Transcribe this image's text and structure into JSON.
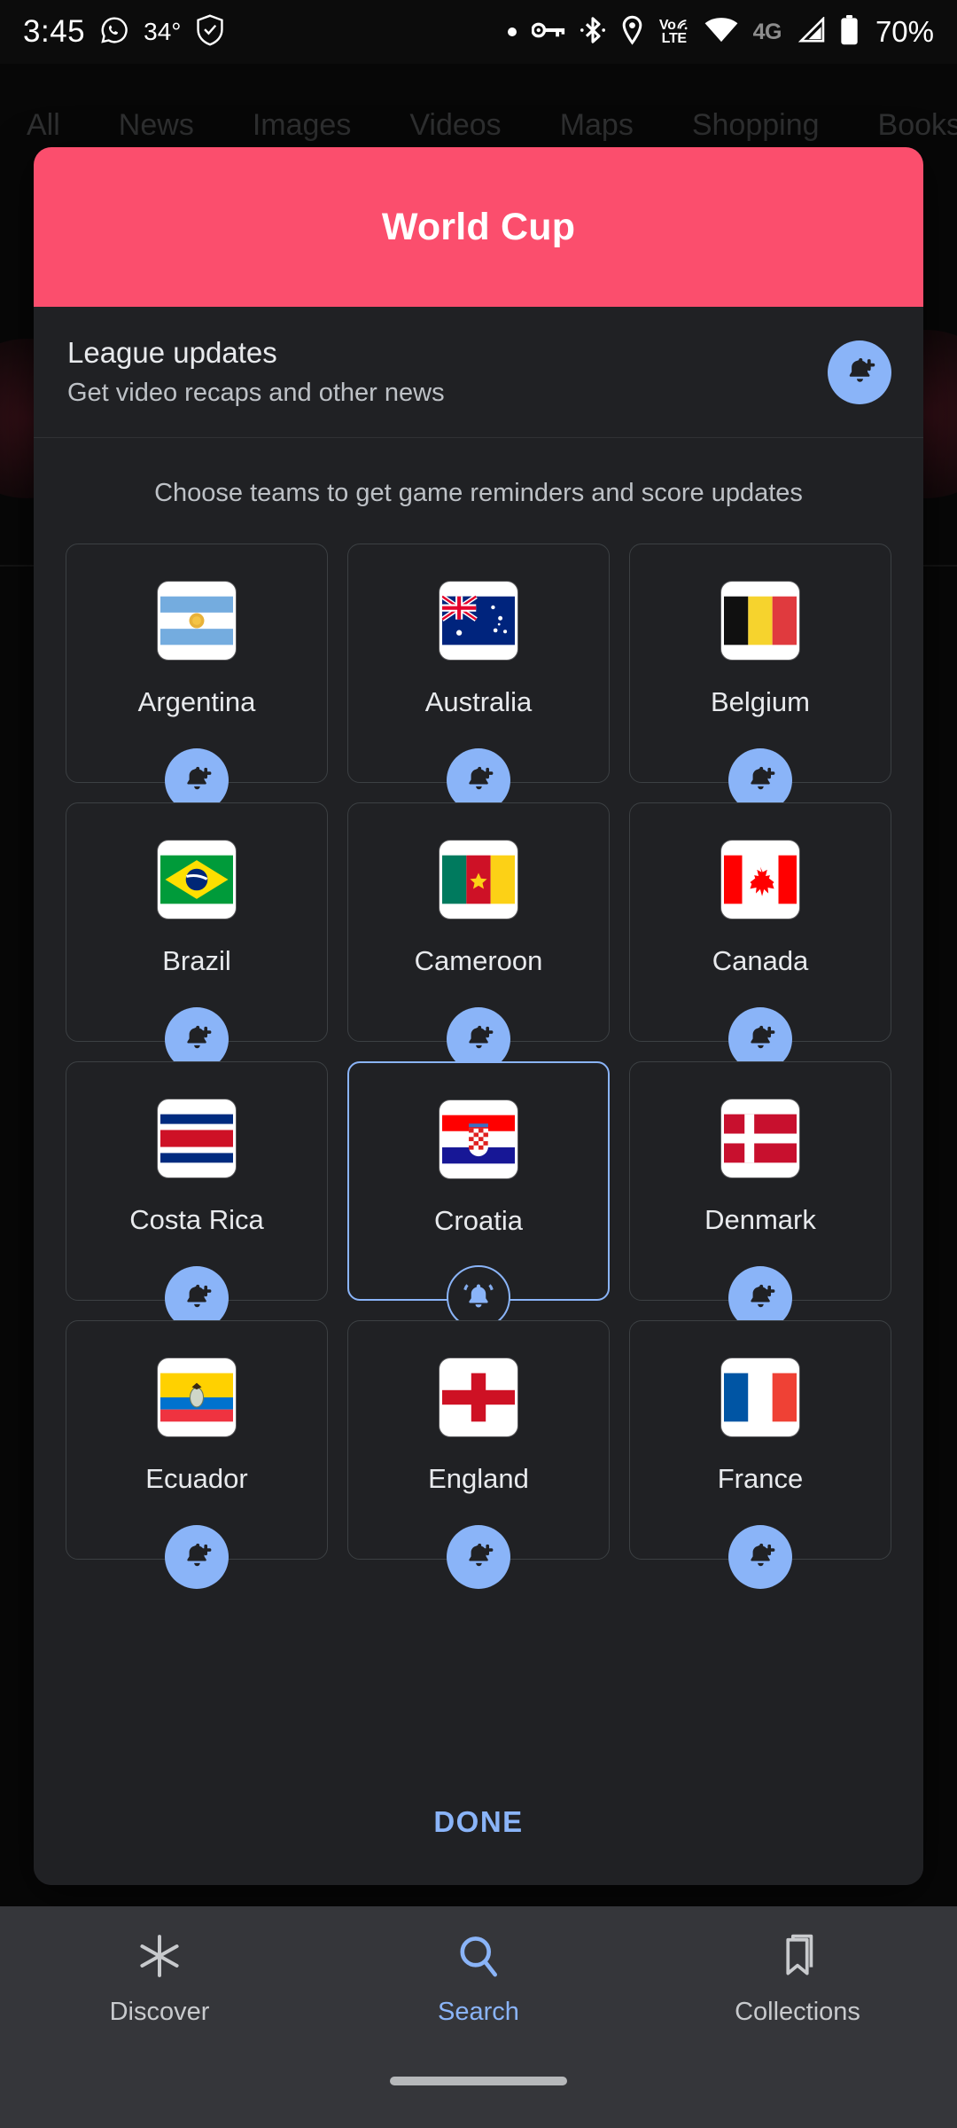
{
  "status_bar": {
    "time": "3:45",
    "temperature": "34°",
    "battery_percent": "70%",
    "network_type": "4G",
    "volte_top": "Vo",
    "volte_bottom": "LTE",
    "icons": [
      "whatsapp-icon",
      "shield-icon",
      "dot-icon",
      "key-icon",
      "bluetooth-icon",
      "location-icon",
      "volte-icon",
      "wifi-icon",
      "signal-icon",
      "battery-icon"
    ]
  },
  "background_page": {
    "tabs": [
      "All",
      "News",
      "Images",
      "Videos",
      "Maps",
      "Shopping",
      "Books"
    ]
  },
  "dialog": {
    "title": "World Cup",
    "header_color": "#fb4e6d",
    "league_updates": {
      "title": "League updates",
      "subtitle": "Get video recaps and other news",
      "bell_state": "add"
    },
    "choose_prompt": "Choose teams to get game reminders and score updates",
    "accent_color": "#8ab4f8",
    "teams": [
      {
        "name": "Argentina",
        "selected": false,
        "bell_state": "add"
      },
      {
        "name": "Australia",
        "selected": false,
        "bell_state": "add"
      },
      {
        "name": "Belgium",
        "selected": false,
        "bell_state": "add"
      },
      {
        "name": "Brazil",
        "selected": false,
        "bell_state": "add"
      },
      {
        "name": "Cameroon",
        "selected": false,
        "bell_state": "add"
      },
      {
        "name": "Canada",
        "selected": false,
        "bell_state": "add"
      },
      {
        "name": "Costa Rica",
        "selected": false,
        "bell_state": "add"
      },
      {
        "name": "Croatia",
        "selected": true,
        "bell_state": "on"
      },
      {
        "name": "Denmark",
        "selected": false,
        "bell_state": "add"
      },
      {
        "name": "Ecuador",
        "selected": false,
        "bell_state": "add"
      },
      {
        "name": "England",
        "selected": false,
        "bell_state": "add"
      },
      {
        "name": "France",
        "selected": false,
        "bell_state": "add"
      }
    ],
    "done_label": "DONE"
  },
  "bottom_nav": {
    "items": [
      {
        "label": "Discover",
        "icon": "asterisk-icon",
        "active": false
      },
      {
        "label": "Search",
        "icon": "search-icon",
        "active": true
      },
      {
        "label": "Collections",
        "icon": "bookmark-icon",
        "active": false
      }
    ]
  }
}
